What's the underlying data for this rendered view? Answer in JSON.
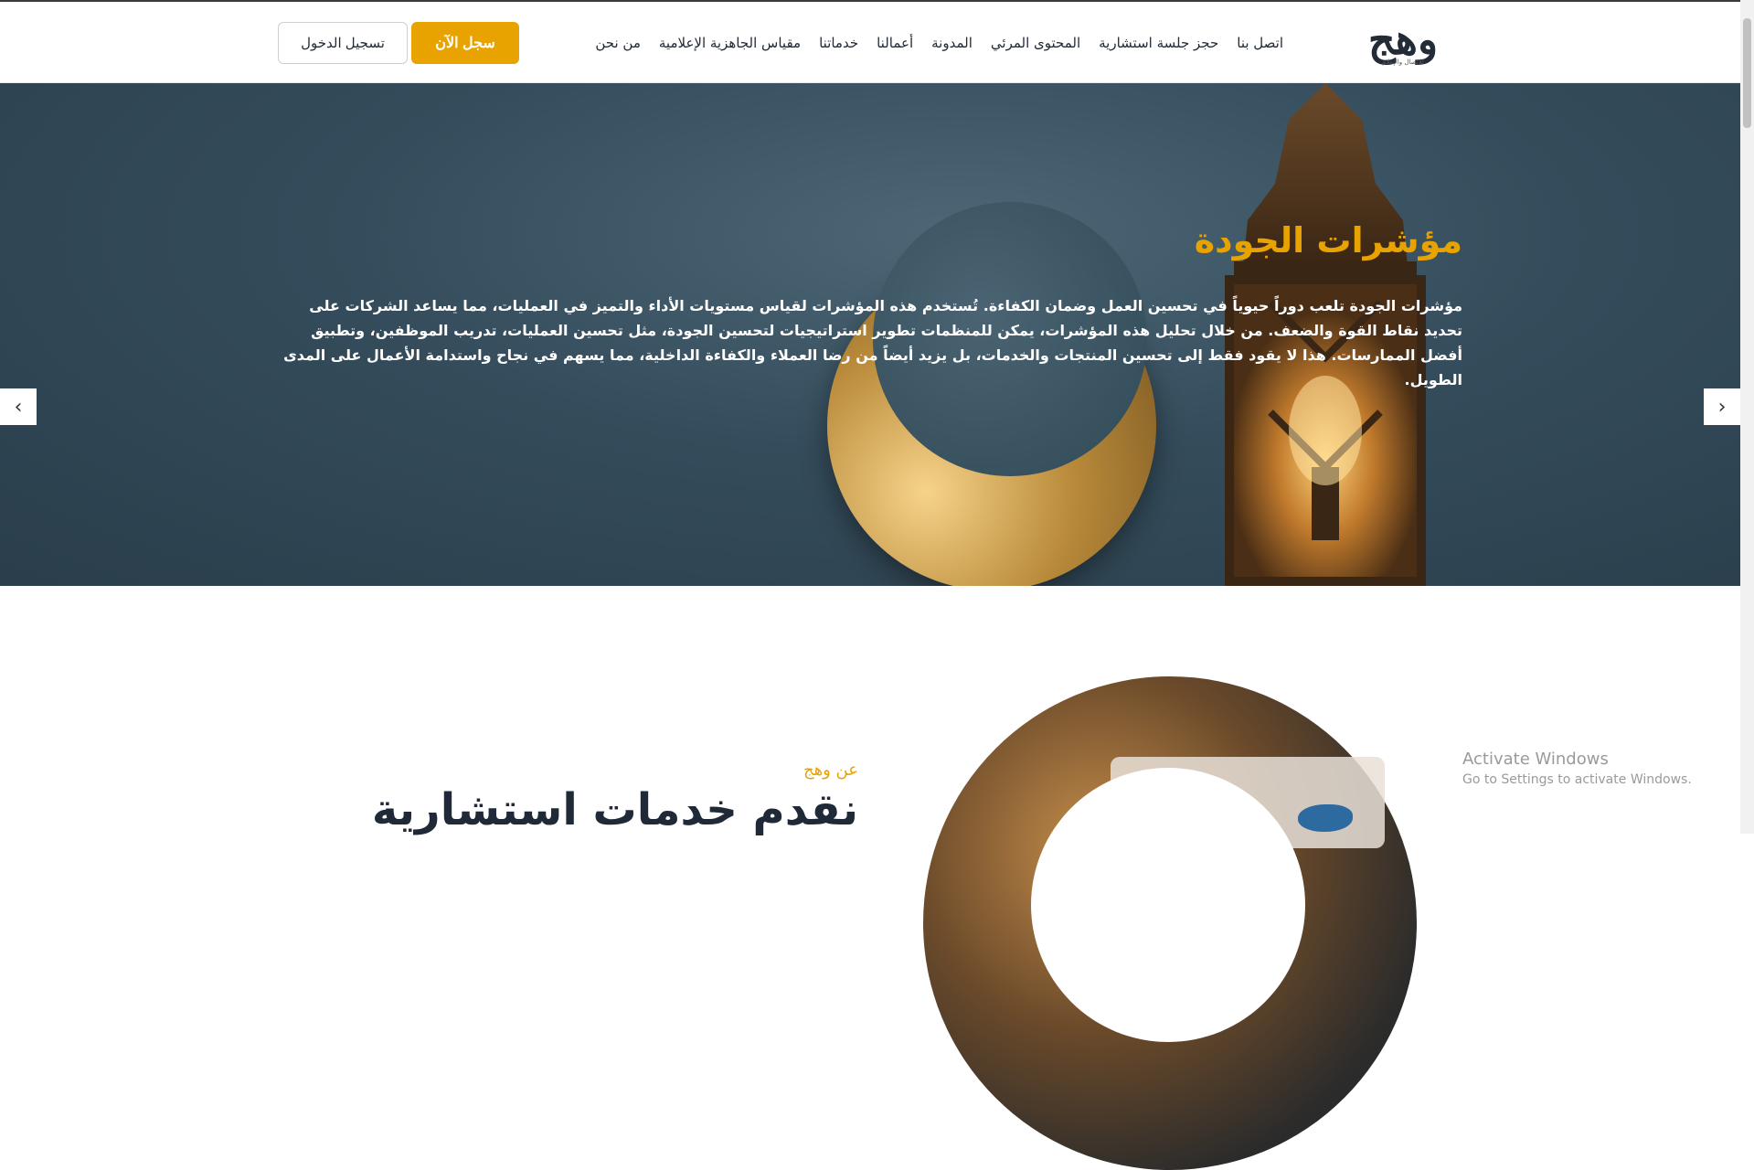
{
  "brand": {
    "logo_text": "وهج",
    "logo_tagline": "للاتصال والإعلام"
  },
  "nav": {
    "items": [
      {
        "label": "من نحن"
      },
      {
        "label": "مقياس الجاهزية الإعلامية"
      },
      {
        "label": "خدماتنا"
      },
      {
        "label": "أعمالنا"
      },
      {
        "label": "المدونة"
      },
      {
        "label": "المحتوى المرئي"
      },
      {
        "label": "حجز جلسة استشارية"
      },
      {
        "label": "اتصل بنا"
      }
    ],
    "register_label": "سجل الآن",
    "login_label": "تسجيل الدخول"
  },
  "hero": {
    "title": "مؤشرات الجودة",
    "text": "مؤشرات الجودة تلعب دوراً حيوياً في تحسين العمل وضمان الكفاءة. تُستخدم هذه المؤشرات لقياس مستويات الأداء والتميز في العمليات، مما يساعد الشركات على تحديد نقاط القوة والضعف. من خلال تحليل هذه المؤشرات، يمكن للمنظمات تطوير استراتيجيات لتحسين الجودة، مثل تحسين العمليات، تدريب الموظفين، وتطبيق أفضل الممارسات. هذا لا يقود فقط إلى تحسين المنتجات والخدمات، بل يزيد أيضاً من رضا العملاء والكفاءة الداخلية، مما يسهم في نجاح واستدامة الأعمال على المدى الطويل.",
    "prev_icon": "‹",
    "next_icon": "›",
    "slides_count": 2,
    "active_slide": 1
  },
  "about": {
    "kicker": "عن وهج",
    "title": "نقدم خدمات استشارية"
  },
  "watermark": {
    "title": "Activate Windows",
    "subtitle": "Go to Settings to activate Windows."
  },
  "colors": {
    "accent": "#e9a300",
    "hero_bg": "#344c5b",
    "text_dark": "#1f2937"
  }
}
